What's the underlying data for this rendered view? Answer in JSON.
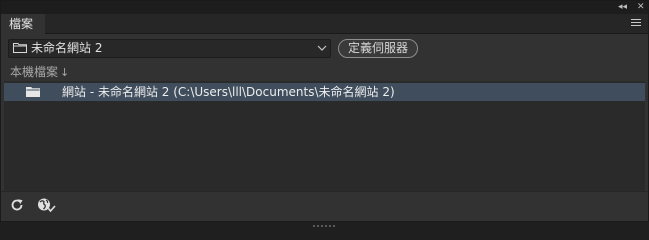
{
  "window": {
    "collapse_glyph": "◂◂",
    "close_glyph": "✕"
  },
  "tab": {
    "label": "檔案"
  },
  "site_selector": {
    "value": "未命名網站 2",
    "icon": "folder-icon"
  },
  "define_server_button": {
    "label": "定義伺服器"
  },
  "local_files": {
    "label": "本機檔案",
    "sort_glyph": "↓"
  },
  "file_list": {
    "items": [
      {
        "label": "網站 - 未命名網站 2 (C:\\Users\\lll\\Documents\\未命名網站 2)",
        "icon": "folder-icon",
        "selected": true
      }
    ]
  },
  "colors": {
    "panel_bg": "#323232",
    "selection_bg": "#3f4d5d",
    "list_bg": "#2a2a2a"
  }
}
